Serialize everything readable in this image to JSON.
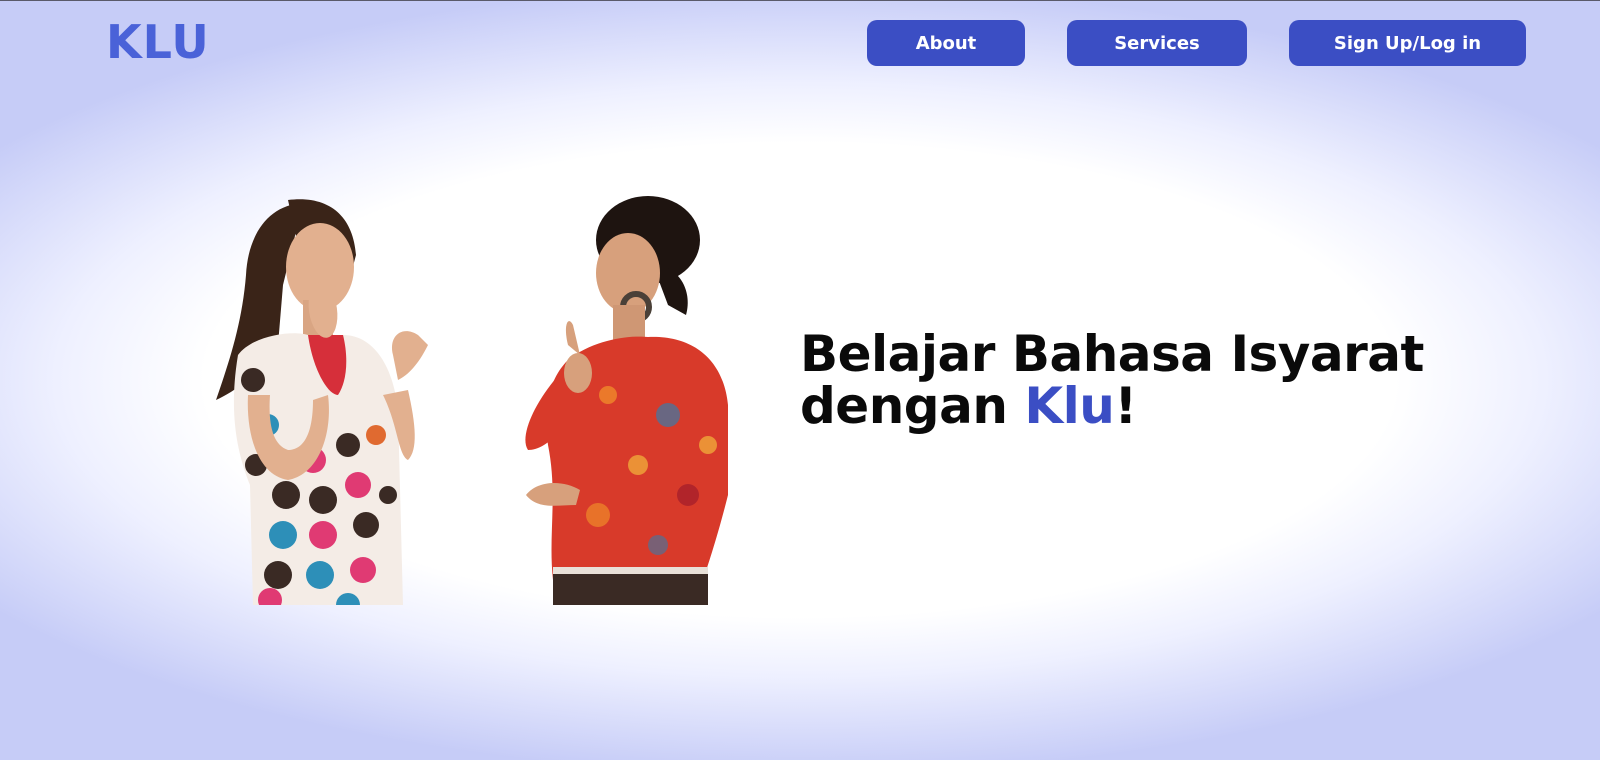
{
  "logo": {
    "text": "KLU"
  },
  "nav": {
    "about_label": "About",
    "services_label": "Services",
    "signup_label": "Sign Up/Log in"
  },
  "hero": {
    "title_line1": "Belajar Bahasa Isyarat",
    "title_line2_prefix": "dengan ",
    "title_brand": "Klu",
    "title_suffix": "!",
    "image_description": "two-women-signing-photo"
  },
  "colors": {
    "primary": "#3b4ec4",
    "logo": "#4a62d8",
    "text": "#0a0a0a",
    "background_edge": "#c6ccf7"
  }
}
